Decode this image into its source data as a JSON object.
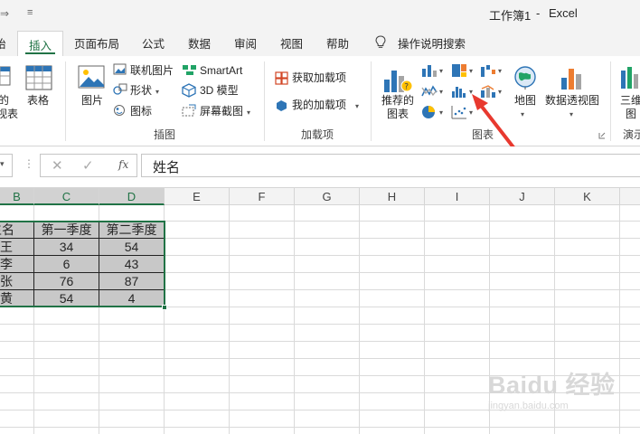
{
  "titlebar": {
    "qat_undo_glyph": "⇒",
    "qat_customize_glyph": "≡",
    "document_title": "工作簿1",
    "separator": "-",
    "app_name": "Excel"
  },
  "tabs": [
    {
      "label": "始"
    },
    {
      "label": "插入",
      "active": true
    },
    {
      "label": "页面布局"
    },
    {
      "label": "公式"
    },
    {
      "label": "数据"
    },
    {
      "label": "审阅"
    },
    {
      "label": "视图"
    },
    {
      "label": "帮助"
    }
  ],
  "tell_me": {
    "label": "操作说明搜索",
    "icon": "lightbulb-icon"
  },
  "ribbon": {
    "tables_group": {
      "pivot_label_line1": "的",
      "pivot_label_line2": "视表",
      "table_label": "表格"
    },
    "illustrations_group": {
      "label": "插图",
      "pictures": "图片",
      "online_pictures": "联机图片",
      "shapes": "形状",
      "icons": "图标",
      "smartart": "SmartArt",
      "models_3d": "3D 模型",
      "screenshot": "屏幕截图"
    },
    "addins_group": {
      "label": "加载项",
      "get_addins": "获取加载项",
      "my_addins": "我的加载项"
    },
    "charts_group": {
      "label": "图表",
      "recommended_line1": "推荐的",
      "recommended_line2": "图表",
      "maps": "地图",
      "pivot_chart": "数据透视图",
      "accent_colors": {
        "blue": "#2e75b6",
        "orange": "#ed7d31",
        "gray": "#a5a5a5",
        "yellow": "#ffc000"
      }
    },
    "tours_group": {
      "label": "演示",
      "map_3d_line1": "三维",
      "map_3d_line2": "图"
    }
  },
  "formula_bar": {
    "cancel_glyph": "✕",
    "enter_glyph": "✓",
    "fx_label": "fx",
    "content": "姓名"
  },
  "columns": [
    "B",
    "C",
    "D",
    "E",
    "F",
    "G",
    "H",
    "I",
    "J",
    "K"
  ],
  "table": {
    "headers": [
      "姓名",
      "第一季度",
      "第二季度"
    ],
    "header_visible": [
      "生名",
      "第一季度",
      "第二季度"
    ],
    "rows": [
      {
        "name": "小王",
        "name_visible": "王",
        "q1": "34",
        "q2": "54"
      },
      {
        "name": "小李",
        "name_visible": "李",
        "q1": "6",
        "q2": "43"
      },
      {
        "name": "小张",
        "name_visible": "张",
        "q1": "76",
        "q2": "87"
      },
      {
        "name": "小黄",
        "name_visible": "黄",
        "q1": "54",
        "q2": "4"
      }
    ]
  },
  "colors": {
    "excel_green": "#217346",
    "selection_fill": "#c8c8c8",
    "annotation_red": "#e8392f"
  },
  "watermark": {
    "logo": "Baidu 经验",
    "url": "jingyan.baidu.com"
  }
}
